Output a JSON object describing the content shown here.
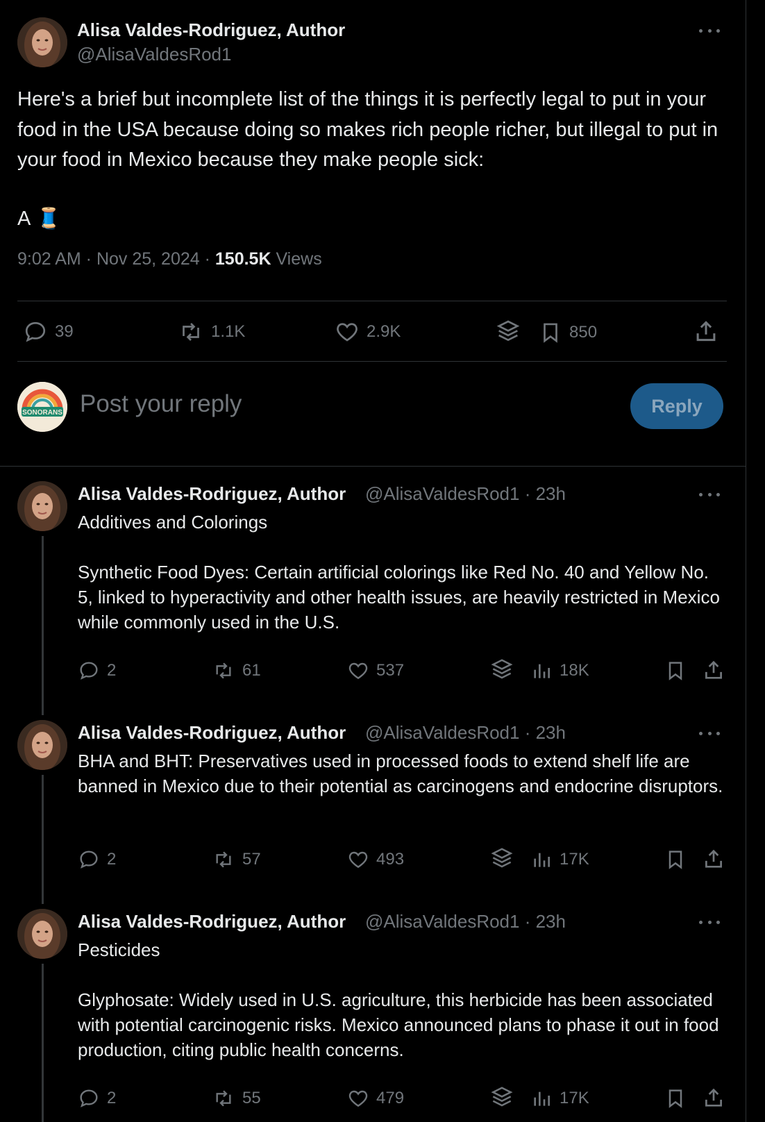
{
  "main_post": {
    "author_name": "Alisa Valdes-Rodriguez, Author",
    "handle": "@AlisaValdesRod1",
    "text": "Here's a brief but incomplete list of the things it is perfectly legal to put in your food in the USA because doing so makes rich people richer, but illegal to put in your food in Mexico because they make people sick:",
    "thread_prefix": "A",
    "thread_emoji": "🧵",
    "timestamp": "9:02 AM · Nov 25, 2024 · ",
    "views_count": "150.5K",
    "views_label": " Views",
    "replies": "39",
    "reposts": "1.1K",
    "likes": "2.9K",
    "bookmarks": "850"
  },
  "composer": {
    "placeholder": "Post your reply",
    "button_label": "Reply",
    "avatar_text": "SONORANS"
  },
  "replies": [
    {
      "author_name": "Alisa Valdes-Rodriguez, Author",
      "handle_time": "@AlisaValdesRod1 · 23h",
      "text": "Additives and Colorings\n\nSynthetic Food Dyes: Certain artificial colorings like Red No. 40 and Yellow No. 5, linked to hyperactivity and other health issues, are heavily restricted in Mexico while commonly used in the U.S.",
      "replies": "2",
      "reposts": "61",
      "likes": "537",
      "views": "18K"
    },
    {
      "author_name": "Alisa Valdes-Rodriguez, Author",
      "handle_time": "@AlisaValdesRod1 · 23h",
      "text": "BHA and BHT: Preservatives used in processed foods to extend shelf life are banned in Mexico due to their potential as carcinogens and endocrine disruptors.",
      "replies": "2",
      "reposts": "57",
      "likes": "493",
      "views": "17K"
    },
    {
      "author_name": "Alisa Valdes-Rodriguez, Author",
      "handle_time": "@AlisaValdesRod1 · 23h",
      "text": "Pesticides\n\nGlyphosate: Widely used in U.S. agriculture, this herbicide has been associated with potential carcinogenic risks. Mexico announced plans to phase it out in food production, citing public health concerns.",
      "replies": "2",
      "reposts": "55",
      "likes": "479",
      "views": "17K"
    }
  ],
  "colors": {
    "background": "#000000",
    "text": "#e7e9ea",
    "muted": "#71767b",
    "border": "#2f3336",
    "reply_button": "#1d5a8a"
  }
}
